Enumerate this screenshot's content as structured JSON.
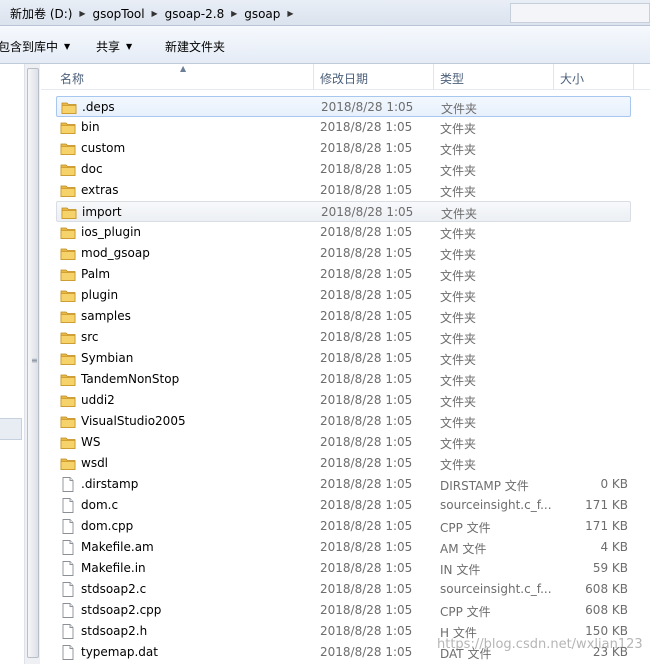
{
  "address": {
    "crumbs": [
      "新加卷 (D:)",
      "gsopTool",
      "gsoap-2.8",
      "gsoap"
    ]
  },
  "toolbar": {
    "include_label": "包含到库中",
    "share_label": "共享",
    "new_folder_label": "新建文件夹"
  },
  "columns": {
    "name": "名称",
    "date": "修改日期",
    "type": "类型",
    "size": "大小"
  },
  "files": [
    {
      "name": ".deps",
      "date": "2018/8/28 1:05",
      "type": "文件夹",
      "size": "",
      "kind": "folder"
    },
    {
      "name": "bin",
      "date": "2018/8/28 1:05",
      "type": "文件夹",
      "size": "",
      "kind": "folder"
    },
    {
      "name": "custom",
      "date": "2018/8/28 1:05",
      "type": "文件夹",
      "size": "",
      "kind": "folder"
    },
    {
      "name": "doc",
      "date": "2018/8/28 1:05",
      "type": "文件夹",
      "size": "",
      "kind": "folder"
    },
    {
      "name": "extras",
      "date": "2018/8/28 1:05",
      "type": "文件夹",
      "size": "",
      "kind": "folder"
    },
    {
      "name": "import",
      "date": "2018/8/28 1:05",
      "type": "文件夹",
      "size": "",
      "kind": "folder"
    },
    {
      "name": "ios_plugin",
      "date": "2018/8/28 1:05",
      "type": "文件夹",
      "size": "",
      "kind": "folder"
    },
    {
      "name": "mod_gsoap",
      "date": "2018/8/28 1:05",
      "type": "文件夹",
      "size": "",
      "kind": "folder"
    },
    {
      "name": "Palm",
      "date": "2018/8/28 1:05",
      "type": "文件夹",
      "size": "",
      "kind": "folder"
    },
    {
      "name": "plugin",
      "date": "2018/8/28 1:05",
      "type": "文件夹",
      "size": "",
      "kind": "folder"
    },
    {
      "name": "samples",
      "date": "2018/8/28 1:05",
      "type": "文件夹",
      "size": "",
      "kind": "folder"
    },
    {
      "name": "src",
      "date": "2018/8/28 1:05",
      "type": "文件夹",
      "size": "",
      "kind": "folder"
    },
    {
      "name": "Symbian",
      "date": "2018/8/28 1:05",
      "type": "文件夹",
      "size": "",
      "kind": "folder"
    },
    {
      "name": "TandemNonStop",
      "date": "2018/8/28 1:05",
      "type": "文件夹",
      "size": "",
      "kind": "folder"
    },
    {
      "name": "uddi2",
      "date": "2018/8/28 1:05",
      "type": "文件夹",
      "size": "",
      "kind": "folder"
    },
    {
      "name": "VisualStudio2005",
      "date": "2018/8/28 1:05",
      "type": "文件夹",
      "size": "",
      "kind": "folder"
    },
    {
      "name": "WS",
      "date": "2018/8/28 1:05",
      "type": "文件夹",
      "size": "",
      "kind": "folder"
    },
    {
      "name": "wsdl",
      "date": "2018/8/28 1:05",
      "type": "文件夹",
      "size": "",
      "kind": "folder"
    },
    {
      "name": ".dirstamp",
      "date": "2018/8/28 1:05",
      "type": "DIRSTAMP 文件",
      "size": "0 KB",
      "kind": "file"
    },
    {
      "name": "dom.c",
      "date": "2018/8/28 1:05",
      "type": "sourceinsight.c_f...",
      "size": "171 KB",
      "kind": "file"
    },
    {
      "name": "dom.cpp",
      "date": "2018/8/28 1:05",
      "type": "CPP 文件",
      "size": "171 KB",
      "kind": "file"
    },
    {
      "name": "Makefile.am",
      "date": "2018/8/28 1:05",
      "type": "AM 文件",
      "size": "4 KB",
      "kind": "file"
    },
    {
      "name": "Makefile.in",
      "date": "2018/8/28 1:05",
      "type": "IN 文件",
      "size": "59 KB",
      "kind": "file"
    },
    {
      "name": "stdsoap2.c",
      "date": "2018/8/28 1:05",
      "type": "sourceinsight.c_f...",
      "size": "608 KB",
      "kind": "file"
    },
    {
      "name": "stdsoap2.cpp",
      "date": "2018/8/28 1:05",
      "type": "CPP 文件",
      "size": "608 KB",
      "kind": "file"
    },
    {
      "name": "stdsoap2.h",
      "date": "2018/8/28 1:05",
      "type": "H 文件",
      "size": "150 KB",
      "kind": "file"
    },
    {
      "name": "typemap.dat",
      "date": "2018/8/28 1:05",
      "type": "DAT 文件",
      "size": "23 KB",
      "kind": "file"
    }
  ],
  "selected_row": 0,
  "hover_row": 5,
  "watermark": "https://blog.csdn.net/wxlian123"
}
